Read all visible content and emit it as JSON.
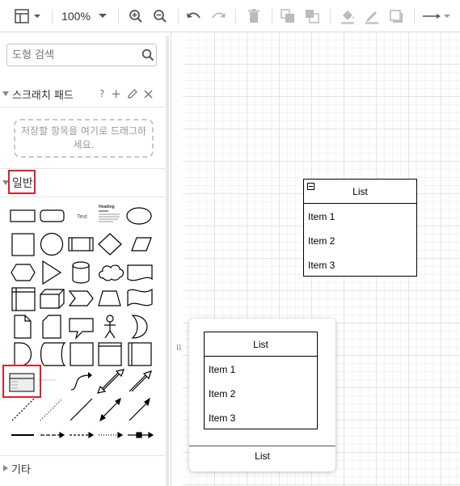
{
  "toolbar": {
    "zoom_label": "100%",
    "icons": [
      "view-icon",
      "zoom-in-icon",
      "zoom-out-icon",
      "undo-icon",
      "redo-icon",
      "delete-icon",
      "to-front-icon",
      "to-back-icon",
      "fill-color-icon",
      "line-color-icon",
      "shadow-icon",
      "connection-arrow-icon"
    ]
  },
  "sidebar": {
    "search": {
      "placeholder": "도형 검색"
    },
    "scratchpad": {
      "title": "스크래치 패드",
      "help": "?",
      "add": "+",
      "drop_hint": "저장할 항목을 여기로 드래그하세요."
    },
    "general": {
      "title": "일반"
    },
    "other": {
      "title": "기타"
    },
    "shape_text_label": "Text",
    "shape_heading_label": "Heading"
  },
  "canvas": {
    "list": {
      "title": "List",
      "items": [
        "Item 1",
        "Item 2",
        "Item 3"
      ]
    },
    "preview": {
      "list_title": "List",
      "items": [
        "Item 1",
        "Item 2",
        "Item 3"
      ],
      "caption": "List"
    },
    "drag_handle": "⁞⁞"
  }
}
